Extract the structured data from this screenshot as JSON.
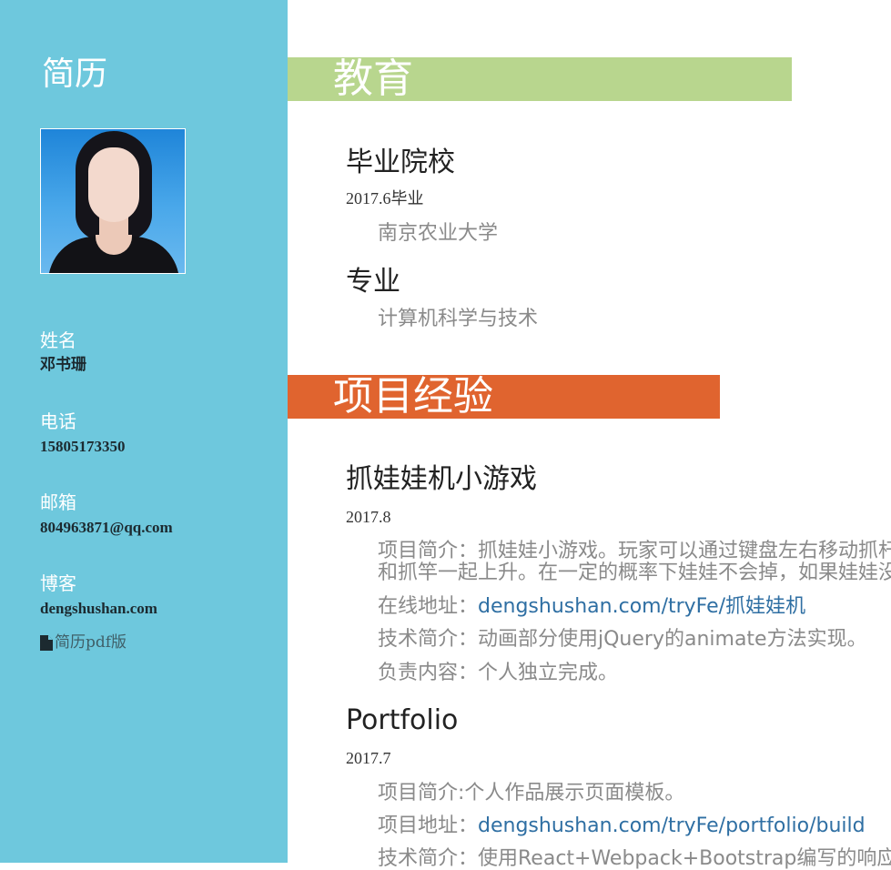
{
  "sidebar": {
    "title": "简历",
    "photo_alt": "profile-photo",
    "name_label": "姓名",
    "name_value": "邓书珊",
    "phone_label": "电话",
    "phone_value": "15805173350",
    "email_label": "邮箱",
    "email_value": "804963871@qq.com",
    "blog_label": "博客",
    "blog_value": "dengshushan.com",
    "pdf_link": "简历pdf版",
    "pdf_icon": "file-icon"
  },
  "colors": {
    "sidebar_bg": "#6ec8dd",
    "education_bar": "#b8d68e",
    "projects_bar": "#e0642f",
    "link": "#2f6fa3"
  },
  "education": {
    "heading": "教育",
    "school_title": "毕业院校",
    "school_date": "2017.6毕业",
    "school_name": "南京农业大学",
    "major_title": "专业",
    "major_name": "计算机科学与技术"
  },
  "projects": {
    "heading": "项目经验",
    "items": [
      {
        "title": "抓娃娃机小游戏",
        "date": "2017.8",
        "desc_line1": "项目简介：抓娃娃小游戏。玩家可以通过键盘左右移动抓杆",
        "desc_line2": "和抓竿一起上升。在一定的概率下娃娃不会掉，如果娃娃没",
        "online_label": "在线地址：",
        "online_link": "dengshushan.com/tryFe/抓娃娃机",
        "tech": "技术简介：动画部分使用jQuery的animate方法实现。",
        "duty": "负责内容：个人独立完成。"
      },
      {
        "title": "Portfolio",
        "date": "2017.7",
        "desc": "项目简介:个人作品展示页面模板。",
        "addr_label": "项目地址：",
        "addr_link": "dengshushan.com/tryFe/portfolio/build",
        "tech": "技术简介：使用React+Webpack+Bootstrap编写的响应"
      }
    ]
  }
}
